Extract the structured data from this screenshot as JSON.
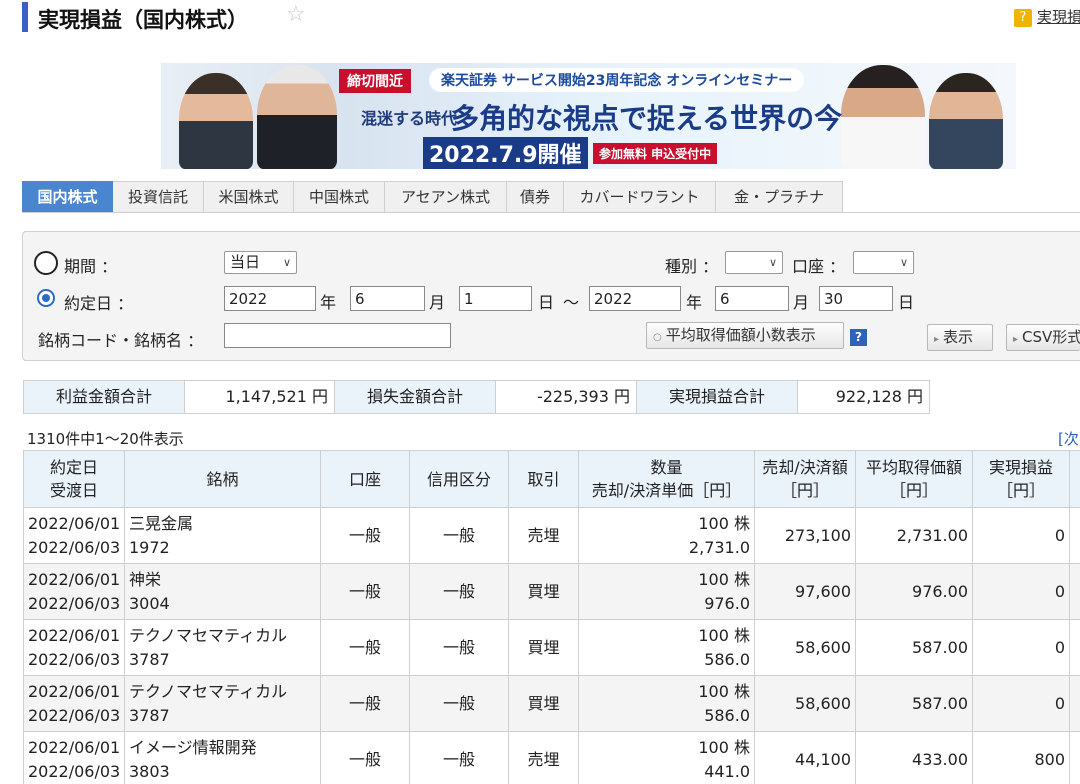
{
  "header": {
    "title": "実現損益（国内株式）",
    "help_link": "実現損益"
  },
  "banner": {
    "tag": "締切間近",
    "headline_top": "楽天証券 サービス開始23周年記念 オンラインセミナー",
    "sub": "混迷する時代",
    "main": "多角的な視点で捉える世界の今",
    "date": "2022.7.9開催",
    "free": "参加無料 申込受付中"
  },
  "tabs": [
    "国内株式",
    "投資信託",
    "米国株式",
    "中国株式",
    "アセアン株式",
    "債券",
    "カバードワラント",
    "金・プラチナ"
  ],
  "search": {
    "period_label": "期間 ：",
    "period_value": "当日",
    "trade_date_label": "約定日 ：",
    "from_year": "2022",
    "from_month": "6",
    "from_day": "1",
    "to_year": "2022",
    "to_month": "6",
    "to_day": "30",
    "unit_year": "年",
    "unit_month": "月",
    "unit_day": "日",
    "tilde": "〜",
    "type_label": "種別 ：",
    "account_label": "口座 ：",
    "code_label": "銘柄コード・銘柄名 ：",
    "code_value": "",
    "avg_button": "平均取得価額小数表示",
    "help_q": "?",
    "show_button": "表示",
    "csv_button": "CSV形式"
  },
  "totals": {
    "profit_label": "利益金額合計",
    "profit_value": "1,147,521 円",
    "loss_label": "損失金額合計",
    "loss_value": "-225,393 円",
    "realized_label": "実現損益合計",
    "realized_value": "922,128 円"
  },
  "pagination": {
    "count": "1310件中1〜20件表示",
    "next": "[次へ"
  },
  "table": {
    "headers": {
      "date_1": "約定日",
      "date_2": "受渡日",
      "stock": "銘柄",
      "account": "口座",
      "credit": "信用区分",
      "trade": "取引",
      "qty_1": "数量",
      "qty_2": "売却/決済単価［円］",
      "amount_1": "売却/決済額",
      "amount_2": "［円］",
      "avg_1": "平均取得価額",
      "avg_2": "［円］",
      "pl_1": "実現損益",
      "pl_2": "［円］"
    },
    "rows": [
      {
        "trade_date": "2022/06/01",
        "settle_date": "2022/06/03",
        "name": "三晃金属",
        "code": "1972",
        "account": "一般",
        "credit": "一般",
        "trade": "売埋",
        "qty": "100 株",
        "price": "2,731.0",
        "amount": "273,100",
        "avg_cost": "2,731.00",
        "pl": "0"
      },
      {
        "trade_date": "2022/06/01",
        "settle_date": "2022/06/03",
        "name": "神栄",
        "code": "3004",
        "account": "一般",
        "credit": "一般",
        "trade": "買埋",
        "qty": "100 株",
        "price": "976.0",
        "amount": "97,600",
        "avg_cost": "976.00",
        "pl": "0"
      },
      {
        "trade_date": "2022/06/01",
        "settle_date": "2022/06/03",
        "name": "テクノマセマティカル",
        "code": "3787",
        "account": "一般",
        "credit": "一般",
        "trade": "買埋",
        "qty": "100 株",
        "price": "586.0",
        "amount": "58,600",
        "avg_cost": "587.00",
        "pl": "0"
      },
      {
        "trade_date": "2022/06/01",
        "settle_date": "2022/06/03",
        "name": "テクノマセマティカル",
        "code": "3787",
        "account": "一般",
        "credit": "一般",
        "trade": "買埋",
        "qty": "100 株",
        "price": "586.0",
        "amount": "58,600",
        "avg_cost": "587.00",
        "pl": "0"
      },
      {
        "trade_date": "2022/06/01",
        "settle_date": "2022/06/03",
        "name": "イメージ情報開発",
        "code": "3803",
        "account": "一般",
        "credit": "一般",
        "trade": "売埋",
        "qty": "100 株",
        "price": "441.0",
        "amount": "44,100",
        "avg_cost": "433.00",
        "pl": "800"
      }
    ]
  }
}
